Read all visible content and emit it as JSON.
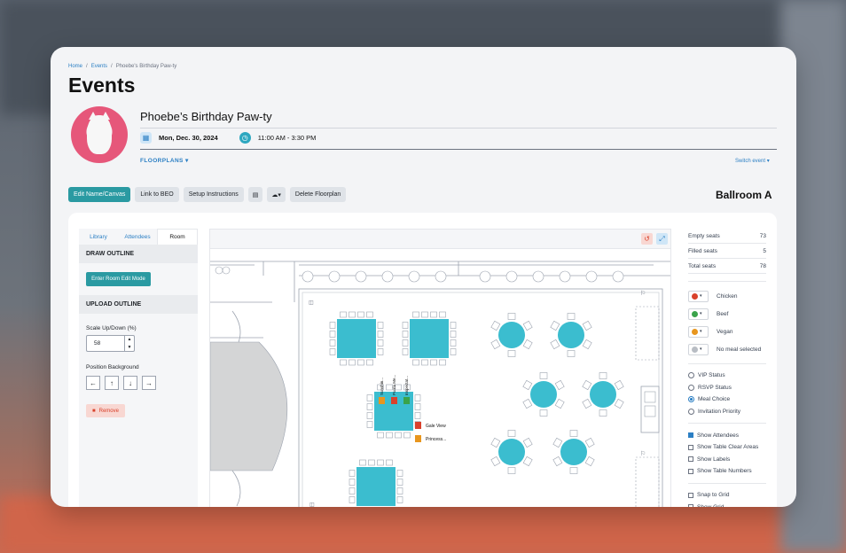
{
  "breadcrumb": [
    "Home",
    "Events",
    "Phoebe's Birthday Paw-ty"
  ],
  "page_title": "Events",
  "event": {
    "name": "Phoebe’s Birthday Paw-ty",
    "date": "Mon, Dec. 30, 2024",
    "time": "11:00 AM - 3:30 PM"
  },
  "floorplans_label": "FLOORPLANS",
  "switch_event": "Switch event",
  "toolbar": {
    "edit": "Edit Name/Canvas",
    "link": "Link to BEO",
    "setup": "Setup Instructions",
    "delete": "Delete Floorplan"
  },
  "room_name": "Ballroom A",
  "left_panel": {
    "tabs": [
      "Library",
      "Attendees",
      "Room"
    ],
    "draw_outline": "DRAW OUTLINE",
    "enter_edit": "Enter Room Edit Mode",
    "upload_outline": "UPLOAD OUTLINE",
    "scale_label": "Scale Up/Down (%)",
    "scale_value": "58",
    "position_label": "Position Background",
    "remove": "Remove"
  },
  "seating": {
    "empty_label": "Empty seats",
    "empty": "73",
    "filled_label": "Filled seats",
    "filled": "5",
    "total_label": "Total seats",
    "total": "78"
  },
  "meals": [
    {
      "label": "Chicken",
      "color": "#d9412b"
    },
    {
      "label": "Beef",
      "color": "#3aa34a"
    },
    {
      "label": "Vegan",
      "color": "#e8961e"
    },
    {
      "label": "No meal selected",
      "color": "#b8bdc4"
    }
  ],
  "status_options": [
    "VIP Status",
    "RSVP Status",
    "Meal Choice",
    "Invitation Priority"
  ],
  "status_selected": "Meal Choice",
  "display_options": [
    {
      "label": "Show Attendees",
      "checked": true
    },
    {
      "label": "Show Table Clear Areas",
      "checked": false
    },
    {
      "label": "Show Labels",
      "checked": false
    },
    {
      "label": "Show Table Numbers",
      "checked": false
    }
  ],
  "grid_options": [
    {
      "label": "Snap to Grid",
      "checked": false
    },
    {
      "label": "Show Grid",
      "checked": false
    }
  ],
  "canvas_labels": {
    "guest1": "Gale View",
    "guest2": "Princess...",
    "rot1": "Sunshin...",
    "rot2": "Purrla Me...",
    "rot3": "Inspectat..."
  },
  "colors": {
    "accent": "#2a9aa2",
    "table": "#3bbdcf",
    "link": "#2b7fc4"
  }
}
